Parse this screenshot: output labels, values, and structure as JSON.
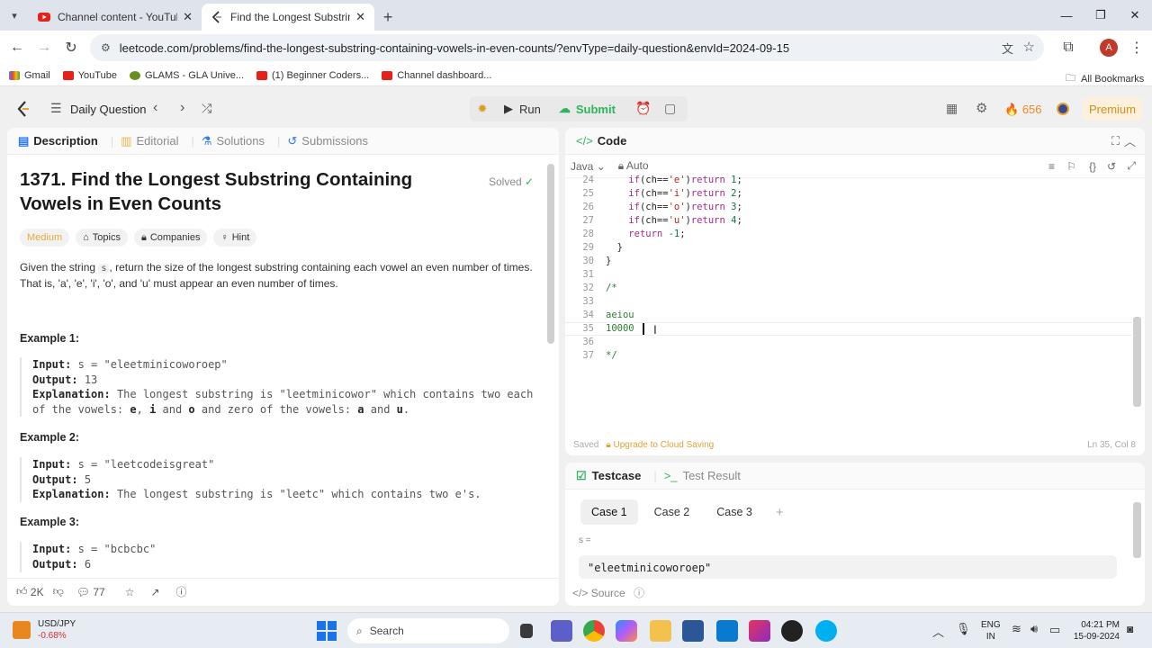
{
  "browser": {
    "tabs": [
      {
        "title": "Channel content - YouTube Stu",
        "favicon": "youtube-icon"
      },
      {
        "title": "Find the Longest Substring Co",
        "favicon": "leetcode-icon"
      }
    ],
    "url": "leetcode.com/problems/find-the-longest-substring-containing-vowels-in-even-counts/?envType=daily-question&envId=2024-09-15",
    "bookmarks": [
      "Gmail",
      "YouTube",
      "GLAMS - GLA Unive...",
      "(1) Beginner Coders...",
      "Channel dashboard..."
    ],
    "all_bookmarks": "All Bookmarks",
    "profile_initial": "A"
  },
  "lcnav": {
    "daily": "Daily Question",
    "run": "Run",
    "submit": "Submit",
    "streak": "656",
    "premium": "Premium"
  },
  "left": {
    "tabs": [
      "Description",
      "Editorial",
      "Solutions",
      "Submissions"
    ],
    "title": "1371. Find the Longest Substring Containing Vowels in Even Counts",
    "solved": "Solved",
    "chips": [
      "Medium",
      "Topics",
      "Companies",
      "Hint"
    ],
    "desc_a": "Given the string ",
    "desc_code": "s",
    "desc_b": ", return the size of the longest substring containing each vowel an even number of times.",
    "desc_c": "That is, 'a', 'e', 'i', 'o', and 'u' must appear an even number of times.",
    "examples": [
      {
        "title": "Example 1:",
        "input": "s = \"eleetminicoworoep\"",
        "output": "13",
        "expl_a": "The longest substring is \"leetminicowor\" which contains two each",
        "expl_b": "of the vowels: ",
        "v1": "e",
        "c1": ", ",
        "v2": "i",
        "c2": " and ",
        "v3": "o",
        "c3": " and zero of the vowels: ",
        "v4": "a",
        "c4": " and ",
        "v5": "u",
        "c5": "."
      },
      {
        "title": "Example 2:",
        "input": "s = \"leetcodeisgreat\"",
        "output": "5",
        "expl": "The longest substring is \"leetc\" which contains two e's."
      },
      {
        "title": "Example 3:",
        "input": "s = \"bcbcbc\"",
        "output": "6"
      }
    ],
    "labels": {
      "input": "Input:",
      "output": "Output:",
      "explanation": "Explanation:"
    },
    "likes": "2K",
    "comments": "77"
  },
  "code": {
    "header": "Code",
    "lang": "Java",
    "mode": "Auto",
    "lines": [
      {
        "n": "24",
        "t": "if(ch=='e')return 1;"
      },
      {
        "n": "25",
        "t": "if(ch=='i')return 2;"
      },
      {
        "n": "26",
        "t": "if(ch=='o')return 3;"
      },
      {
        "n": "27",
        "t": "if(ch=='u')return 4;"
      },
      {
        "n": "28",
        "t": "return -1;"
      },
      {
        "n": "29",
        "t": "}"
      },
      {
        "n": "30",
        "t": "}"
      },
      {
        "n": "31",
        "t": ""
      },
      {
        "n": "32",
        "t": "/*"
      },
      {
        "n": "33",
        "t": ""
      },
      {
        "n": "34",
        "t": "aeiou"
      },
      {
        "n": "35",
        "t": "10000"
      },
      {
        "n": "36",
        "t": ""
      },
      {
        "n": "37",
        "t": "*/"
      }
    ],
    "saved": "Saved",
    "upgrade": "Upgrade to Cloud Saving",
    "position": "Ln 35, Col 8"
  },
  "testcase": {
    "tabs": [
      "Testcase",
      "Test Result"
    ],
    "cases": [
      "Case 1",
      "Case 2",
      "Case 3"
    ],
    "var_label": "s =",
    "value": "\"eleetminicoworoep\"",
    "source": "Source"
  },
  "taskbar": {
    "stock_name": "USD/JPY",
    "stock_change": "-0.68%",
    "search": "Search",
    "lang1": "ENG",
    "lang2": "IN",
    "time": "04:21 PM",
    "date": "15-09-2024"
  }
}
